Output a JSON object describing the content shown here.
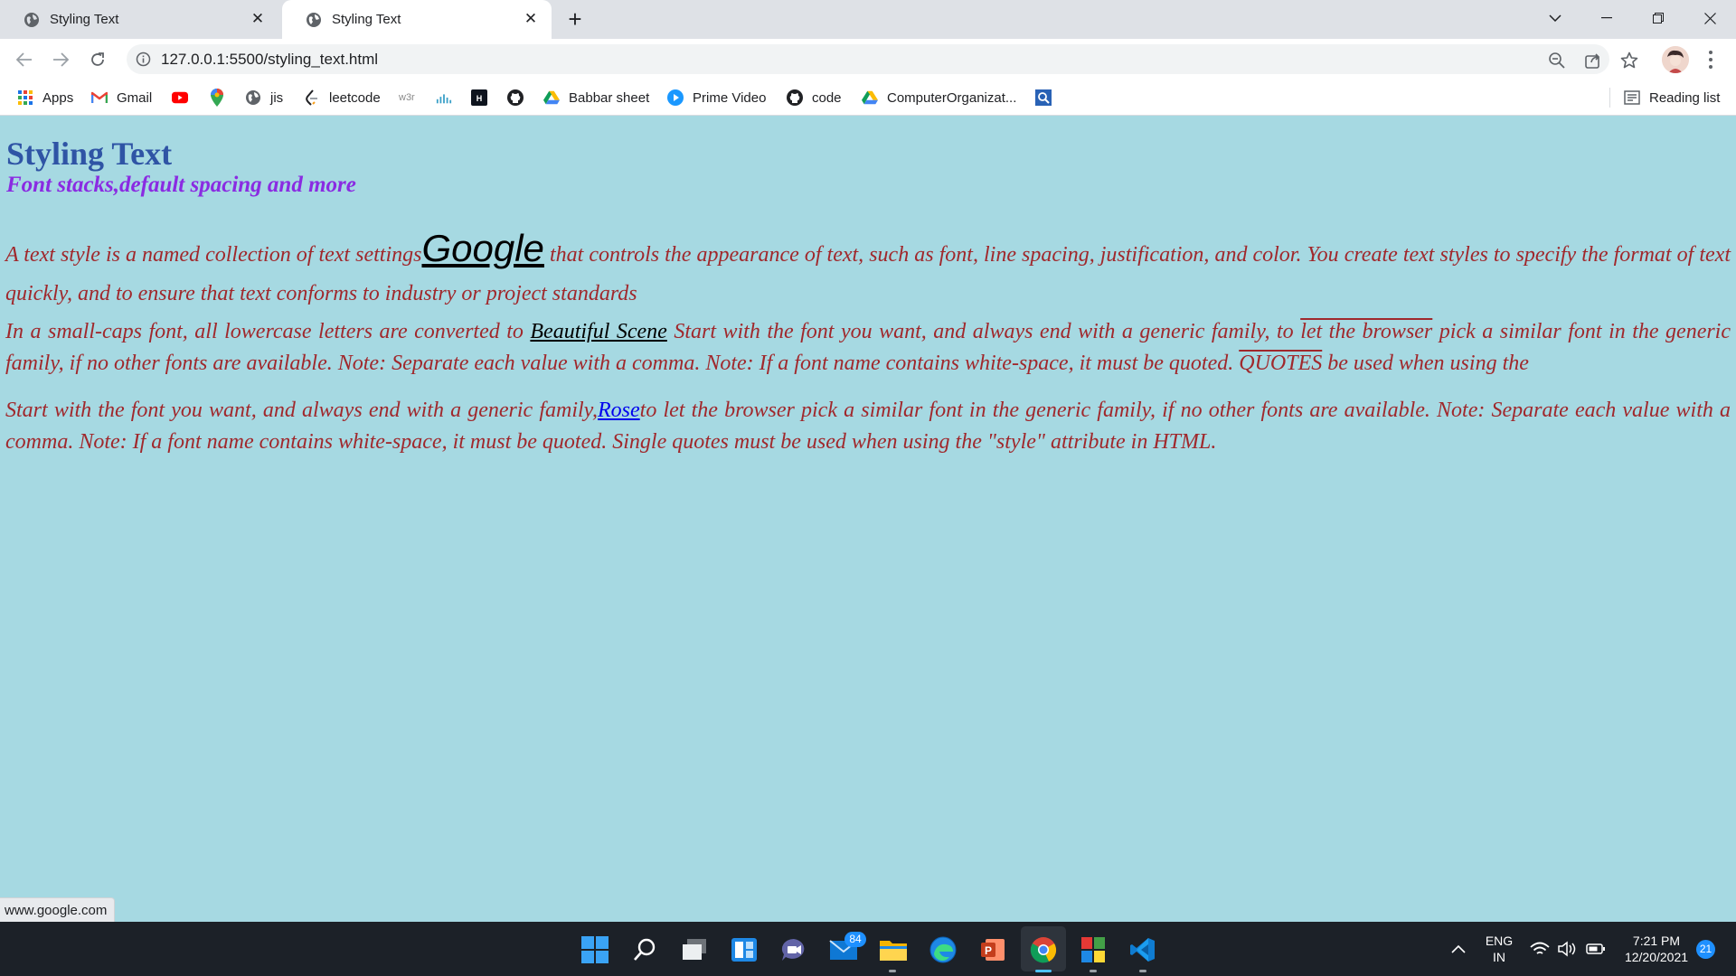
{
  "browser": {
    "tabs": [
      {
        "title": "Styling Text",
        "active": false
      },
      {
        "title": "Styling Text",
        "active": true
      }
    ],
    "url": "127.0.0.1:5500/styling_text.html",
    "bookmarks": [
      {
        "label": "Apps",
        "icon": "apps-grid-icon"
      },
      {
        "label": "Gmail",
        "icon": "gmail-icon"
      },
      {
        "label": "",
        "icon": "youtube-icon"
      },
      {
        "label": "",
        "icon": "maps-pin-icon"
      },
      {
        "label": "jis",
        "icon": "globe-icon"
      },
      {
        "label": "leetcode",
        "icon": "leetcode-icon"
      },
      {
        "label": "w3r",
        "icon": "w3r-icon"
      },
      {
        "label": "",
        "icon": "chart-icon"
      },
      {
        "label": "",
        "icon": "hackerrank-icon"
      },
      {
        "label": "",
        "icon": "github-icon"
      },
      {
        "label": "Babbar sheet",
        "icon": "google-drive-icon"
      },
      {
        "label": "Prime Video",
        "icon": "prime-video-icon"
      },
      {
        "label": "code",
        "icon": "github-icon"
      },
      {
        "label": "ComputerOrganizat...",
        "icon": "google-drive-icon"
      },
      {
        "label": "",
        "icon": "search-box-icon"
      }
    ],
    "reading_list": "Reading list",
    "status_url": "www.google.com"
  },
  "page": {
    "heading": "Styling Text",
    "subheading": "Font stacks,default spacing and more",
    "p1": {
      "before": "A text style is a named collection of text settings",
      "link": "Google",
      "after": " that controls the appearance of text, such as font, line spacing, justification, and color. You create text styles to specify the format of text quickly, and to ensure that text conforms to industry or project standards"
    },
    "p2": {
      "before": "In a small-caps font, all lowercase letters are converted to ",
      "link": "Beautiful Scene",
      "mid": " Start with the font you want, and always end with a generic family, to ",
      "overlined": "let the browser",
      "mid2": " pick a similar font in the generic family, if no other fonts are available. Note: Separate each value with a comma. Note: If a font name contains white-space, it must be quoted. ",
      "quotes": "QUOTES",
      "after": " be used when using the"
    },
    "p3": {
      "before": "Start with the font you want, and always end with a generic family,",
      "link": "Rose",
      "after": "to let the browser pick a similar font in the generic family, if no other fonts are available. Note: Separate each value with a comma. Note: If a font name contains white-space, it must be quoted. Single quotes must be used when using the \"style\" attribute in HTML."
    },
    "colors": {
      "background": "#a6d9e2",
      "heading": "#2f54a5",
      "subheading": "#8a2be2",
      "body_text": "#a0282c"
    }
  },
  "taskbar": {
    "mail_badge": "84",
    "lang_line1": "ENG",
    "lang_line2": "IN",
    "time": "7:21 PM",
    "date": "12/20/2021",
    "notification_count": "21"
  }
}
